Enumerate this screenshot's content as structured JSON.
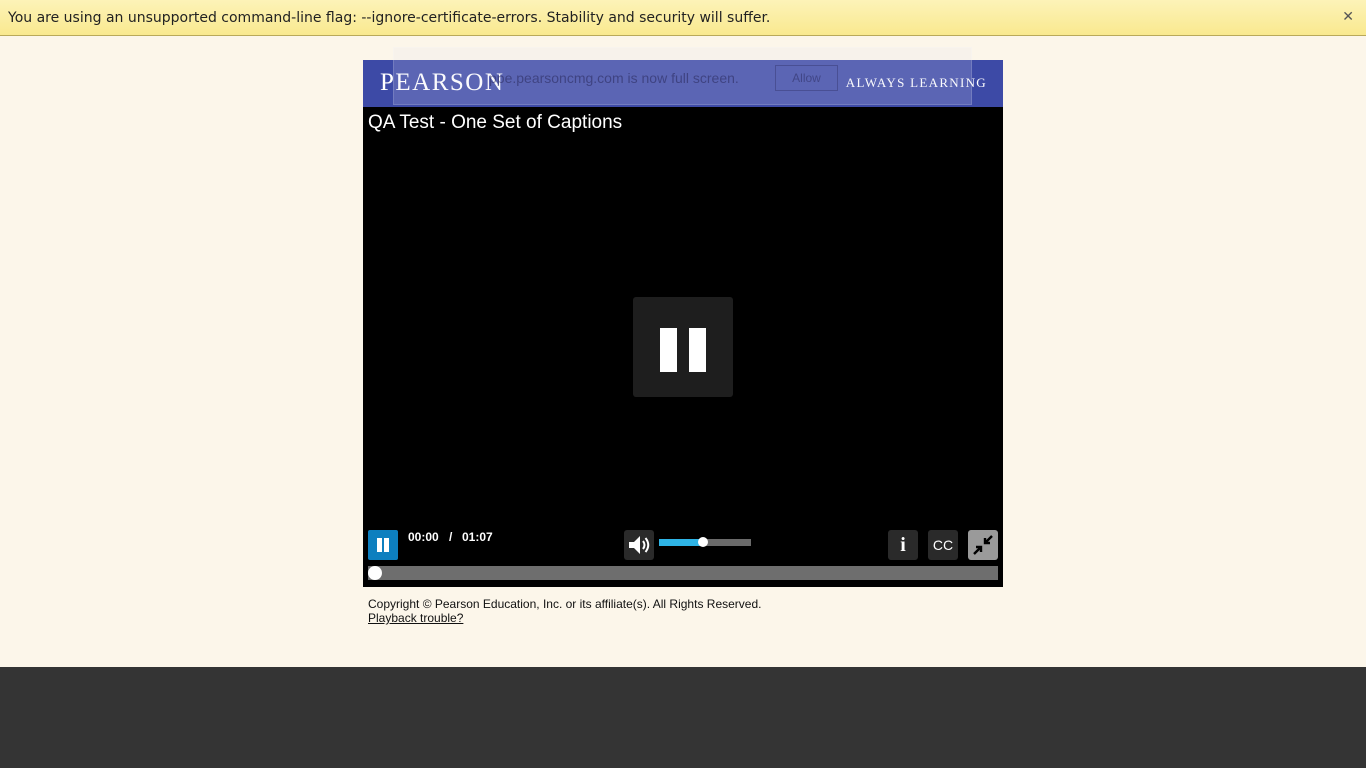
{
  "infobar": {
    "message": "You are using an unsupported command-line flag: --ignore-certificate-errors. Stability and security will suffer.",
    "close_icon": "close-icon"
  },
  "header": {
    "logo": "PEARSON",
    "tagline": "ALWAYS LEARNING"
  },
  "fullscreen_notice": {
    "message": "ppe.pearsoncmg.com is now full screen.",
    "allow_label": "Allow"
  },
  "video": {
    "title": "QA Test - One Set of Captions",
    "center_icon": "pause-icon"
  },
  "controls": {
    "current_time": "00:00",
    "separator": "/",
    "duration": "01:07",
    "volume_fraction": 0.48,
    "progress_fraction": 0.0,
    "cc_label": "CC",
    "info_label": "i",
    "icons": [
      "pause-icon",
      "volume-icon",
      "info-icon",
      "closed-captions-icon",
      "exit-fullscreen-icon"
    ],
    "accent_color": "#0d7fbf",
    "volume_color": "#2eb4e6"
  },
  "footer": {
    "copyright": "Copyright © Pearson Education, Inc. or its affiliate(s). All Rights Reserved.",
    "link": "Playback trouble?"
  },
  "colors": {
    "page_background": "#fcf6ea",
    "brand_blue": "#3d4aa6",
    "infobar_yellow": "#f9e98f",
    "bottom_band": "#343434"
  }
}
